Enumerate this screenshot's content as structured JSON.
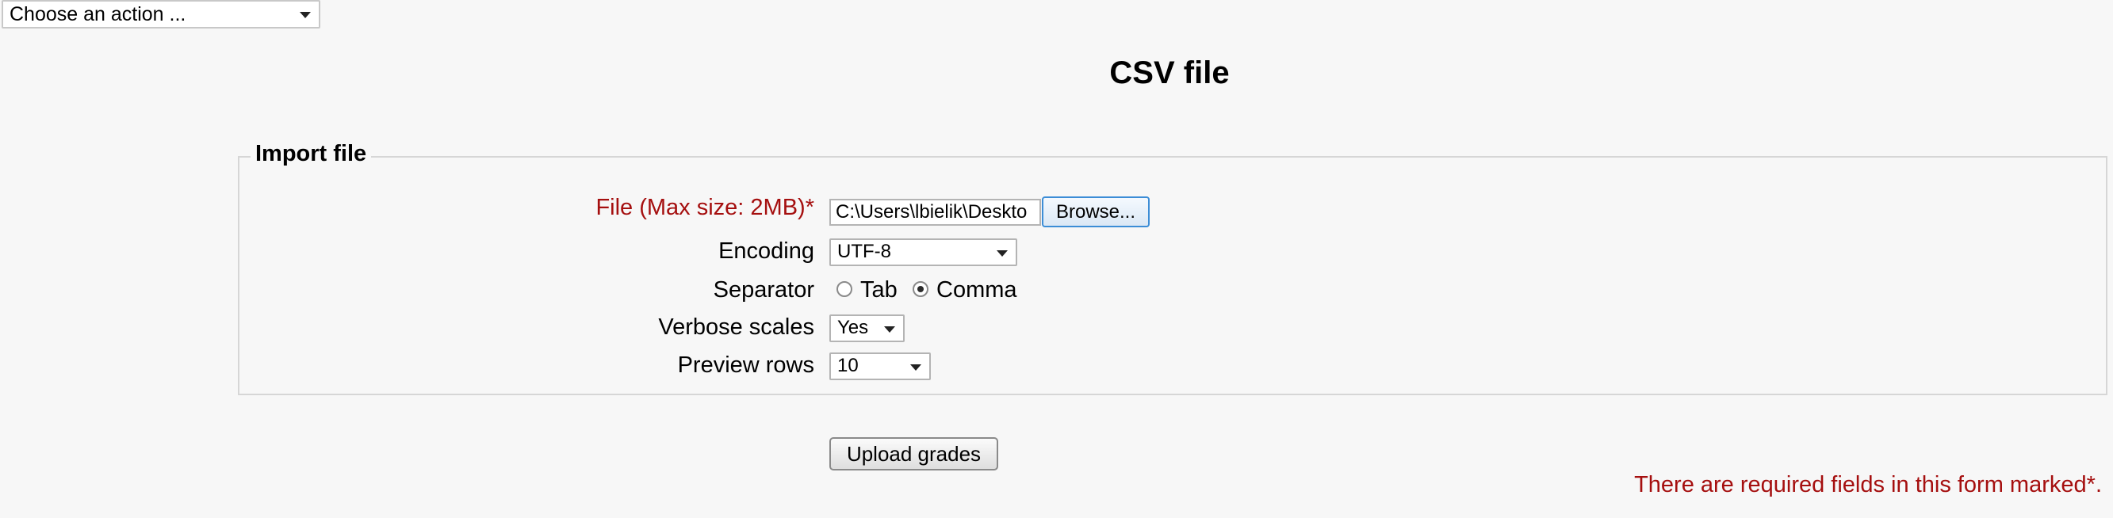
{
  "action_select": {
    "value": "Choose an action ..."
  },
  "page_title": "CSV file",
  "import_section": {
    "legend": "Import file",
    "file": {
      "label": "File (Max size: 2MB)",
      "required_marker": "*",
      "value": "C:\\Users\\lbielik\\Deskto",
      "browse_label": "Browse..."
    },
    "encoding": {
      "label": "Encoding",
      "value": "UTF-8"
    },
    "separator": {
      "label": "Separator",
      "options": [
        {
          "label": "Tab",
          "checked": false
        },
        {
          "label": "Comma",
          "checked": true
        }
      ]
    },
    "verbose_scales": {
      "label": "Verbose scales",
      "value": "Yes"
    },
    "preview_rows": {
      "label": "Preview rows",
      "value": "10"
    }
  },
  "upload_button": "Upload grades",
  "required_note": {
    "text": "There are required fields in this form marked",
    "marker": "*",
    "suffix": "."
  },
  "colors": {
    "required": "#a50f0f",
    "focus_border": "#3c8dd6",
    "background": "#f7f7f7"
  }
}
